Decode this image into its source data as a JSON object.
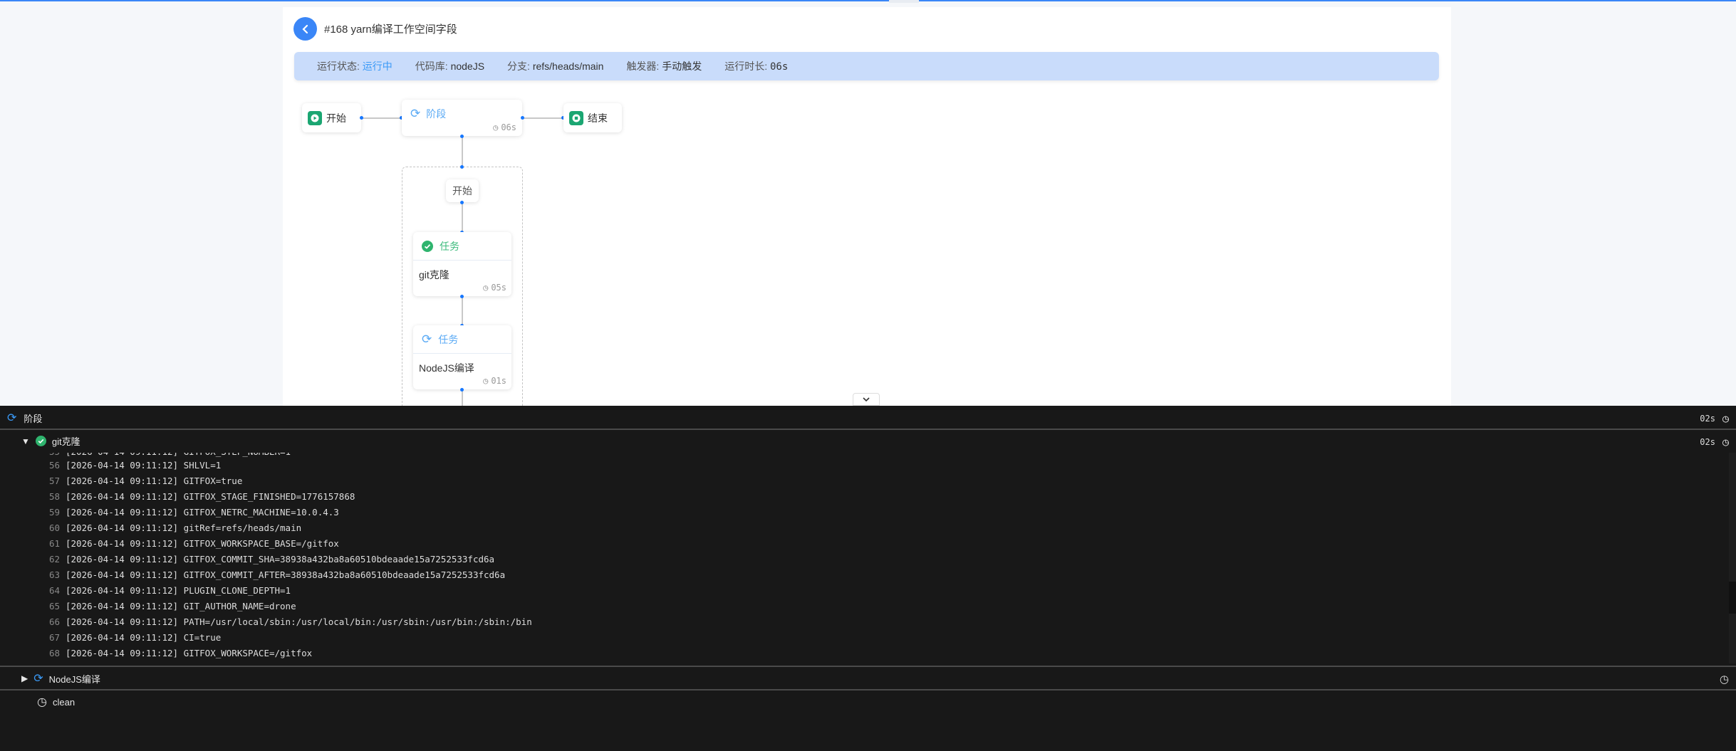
{
  "header": {
    "title": "#168 yarn编译工作空间字段"
  },
  "info": {
    "status_label": "运行状态:",
    "status_value": "运行中",
    "repo_label": "代码库:",
    "repo_value": "nodeJS",
    "branch_label": "分支:",
    "branch_value": "refs/heads/main",
    "trigger_label": "触发器:",
    "trigger_value": "手动触发",
    "duration_label": "运行时长:",
    "duration_value": "06s"
  },
  "pipeline": {
    "start": "开始",
    "stage": "阶段",
    "stage_duration": "06s",
    "end": "结束",
    "inner_start": "开始",
    "tasks": [
      {
        "type": "任务",
        "name": "git克隆",
        "duration": "05s",
        "status": "success"
      },
      {
        "type": "任务",
        "name": "NodeJS编译",
        "duration": "01s",
        "status": "running"
      }
    ]
  },
  "logs": {
    "stage_label": "阶段",
    "stage_duration": "02s",
    "step1": {
      "name": "git克隆",
      "duration": "02s"
    },
    "lines": [
      {
        "n": "56",
        "t": "[2026-04-14 09:11:12] SHLVL=1"
      },
      {
        "n": "57",
        "t": "[2026-04-14 09:11:12] GITFOX=true"
      },
      {
        "n": "58",
        "t": "[2026-04-14 09:11:12] GITFOX_STAGE_FINISHED=1776157868"
      },
      {
        "n": "59",
        "t": "[2026-04-14 09:11:12] GITFOX_NETRC_MACHINE=10.0.4.3"
      },
      {
        "n": "60",
        "t": "[2026-04-14 09:11:12] gitRef=refs/heads/main"
      },
      {
        "n": "61",
        "t": "[2026-04-14 09:11:12] GITFOX_WORKSPACE_BASE=/gitfox"
      },
      {
        "n": "62",
        "t": "[2026-04-14 09:11:12] GITFOX_COMMIT_SHA=38938a432ba8a60510bdeaade15a7252533fcd6a"
      },
      {
        "n": "63",
        "t": "[2026-04-14 09:11:12] GITFOX_COMMIT_AFTER=38938a432ba8a60510bdeaade15a7252533fcd6a"
      },
      {
        "n": "64",
        "t": "[2026-04-14 09:11:12] PLUGIN_CLONE_DEPTH=1"
      },
      {
        "n": "65",
        "t": "[2026-04-14 09:11:12] GIT_AUTHOR_NAME=drone"
      },
      {
        "n": "66",
        "t": "[2026-04-14 09:11:12] PATH=/usr/local/sbin:/usr/local/bin:/usr/sbin:/usr/bin:/sbin:/bin"
      },
      {
        "n": "67",
        "t": "[2026-04-14 09:11:12] CI=true"
      },
      {
        "n": "68",
        "t": "[2026-04-14 09:11:12] GITFOX_WORKSPACE=/gitfox"
      }
    ],
    "step2": {
      "name": "NodeJS编译"
    },
    "step3": {
      "name": "clean"
    }
  }
}
